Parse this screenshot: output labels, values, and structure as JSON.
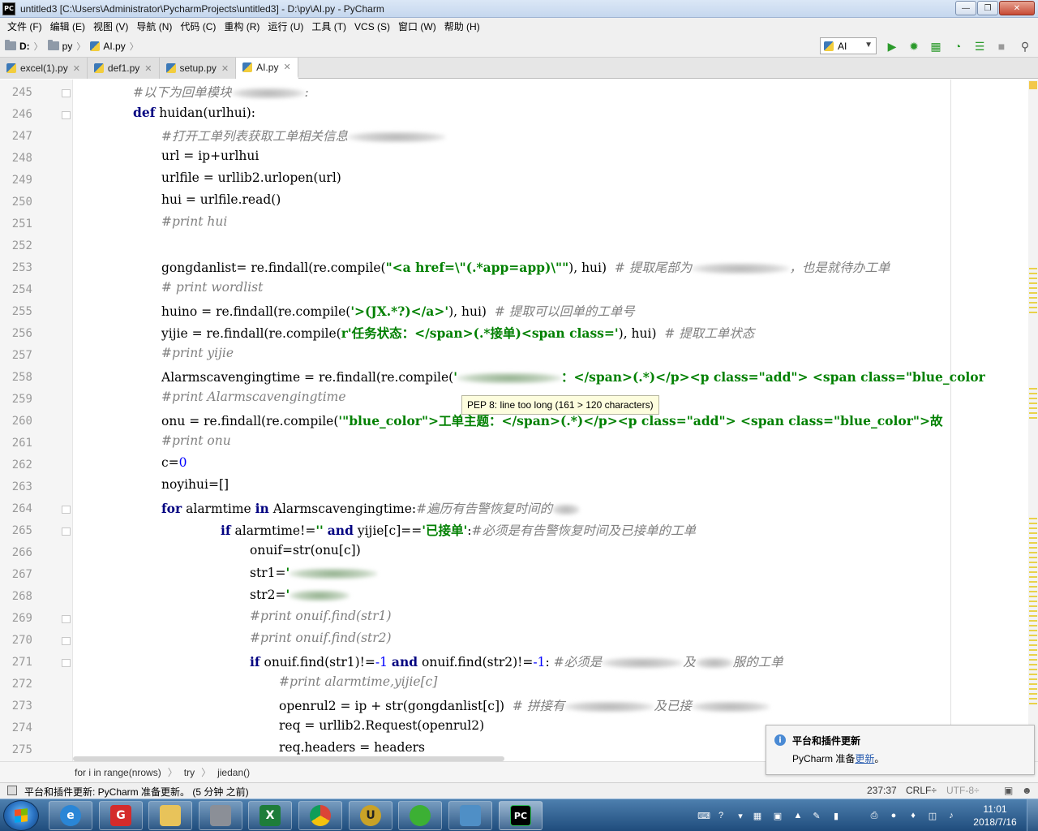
{
  "window": {
    "app_icon_text": "PC",
    "title": "untitled3 [C:\\Users\\Administrator\\PycharmProjects\\untitled3] - D:\\py\\AI.py - PyCharm"
  },
  "menu": [
    "文件 (F)",
    "编辑 (E)",
    "视图 (V)",
    "导航 (N)",
    "代码 (C)",
    "重构 (R)",
    "运行 (U)",
    "工具 (T)",
    "VCS (S)",
    "窗口 (W)",
    "帮助 (H)"
  ],
  "navbar": {
    "crumbs": [
      "D:",
      "py",
      "AI.py"
    ],
    "run_config": "AI"
  },
  "tabs": [
    {
      "label": "excel(1).py",
      "active": false
    },
    {
      "label": "def1.py",
      "active": false
    },
    {
      "label": "setup.py",
      "active": false
    },
    {
      "label": "AI.py",
      "active": true
    }
  ],
  "editor": {
    "line_numbers": [
      "245",
      "246",
      "247",
      "248",
      "249",
      "250",
      "251",
      "252",
      "253",
      "254",
      "255",
      "256",
      "257",
      "258",
      "259",
      "260",
      "261",
      "262",
      "263",
      "264",
      "265",
      "266",
      "267",
      "268",
      "269",
      "270",
      "271",
      "272",
      "273",
      "274",
      "275"
    ],
    "lines": {
      "l245": "#以下为回单模块",
      "l245b": ":",
      "l246_kw": "def",
      "l246_rest": " huidan(urlhui):",
      "l247": "#打开工单列表获取工单相关信息",
      "l248": "url = ip+urlhui",
      "l249": "urlfile = urllib2.urlopen(url)",
      "l250": "hui = urlfile.read()",
      "l251": "#print hui",
      "l253_a": "gongdanlist= re.findall(re.compile(",
      "l253_s": "\"<a href=\\\"(.*app=app)\\\"\"",
      "l253_b": "), hui)  ",
      "l253_c": "# 提取尾部为",
      "l253_d": "，也是就待办工单",
      "l254": "# print wordlist",
      "l255_a": "huino = re.findall(re.compile(",
      "l255_s": "'>(JX.*?)</a>'",
      "l255_b": "), hui)  ",
      "l255_c": "# 提取可以回单的工单号",
      "l256_a": "yijie = re.findall(re.compile(",
      "l256_s": "r'任务状态：</span>(.*接单)<span class='",
      "l256_b": "), hui)  ",
      "l256_c": "# 提取工单状态",
      "l257": "#print yijie",
      "l258_a": "Alarmscavengingtime = re.findall(re.compile(",
      "l258_s1": "'",
      "l258_s2": "：</span>(.*)</p><p class=\"add\"> <span class=\"blue_color",
      "l259": "#print Alarmscavengingtime",
      "l260_a": "onu = re.findall(re.compile(",
      "l260_s": "'\"blue_color\">工单主题：</span>(.*)</p><p class=\"add\"> <span class=\"blue_color\">故",
      "l261": "#print onu",
      "l262_a": "c=",
      "l262_n": "0",
      "l263": "noyihui=[]",
      "l264_kw1": "for",
      "l264_a": " alarmtime ",
      "l264_kw2": "in",
      "l264_b": " Alarmscavengingtime:",
      "l264_c": "#遍历有告警恢复时间的",
      "l265_kw1": "if",
      "l265_a": " alarmtime!=",
      "l265_s1": "''",
      "l265_kw2": "and",
      "l265_b": " yijie[c]==",
      "l265_s2": "'已接单'",
      "l265_c": ":",
      "l265_d": "#必须是有告警恢复时间及已接单的工单",
      "l266": "onuif=str(onu[c])",
      "l267_a": "str1=",
      "l267_s": "'",
      "l268_a": "str2=",
      "l268_s": "'",
      "l269": "#print onuif.find(str1)",
      "l270": "#print onuif.find(str2)",
      "l271_kw": "if",
      "l271_a": " onuif.find(str1)!=",
      "l271_n1": "-1",
      "l271_kw2": "and",
      "l271_b": " onuif.find(str2)!=",
      "l271_n2": "-1",
      "l271_c": ": ",
      "l271_d": "#必须是",
      "l271_e": "及",
      "l271_f": "服的工单",
      "l272": "#print alarmtime,yijie[c]",
      "l273_a": "openrul2 = ip + str(gongdanlist[c])  ",
      "l273_c": "# 拼接有",
      "l273_d": "及已接",
      "l274": "req = urllib2.Request(openrul2)",
      "l275": "req.headers = headers"
    },
    "tooltip": "PEP 8: line too long (161 > 120 characters)"
  },
  "code_breadcrumb": [
    "for i in range(nrows)",
    "try",
    "jiedan()"
  ],
  "notification": {
    "title": "平台和插件更新",
    "body_prefix": "PyCharm 准备",
    "link": "更新",
    "body_suffix": "。"
  },
  "statusbar": {
    "message": "平台和插件更新: PyCharm 准备更新。 (5 分钟 之前)",
    "position": "237:37",
    "line_sep": "CRLF÷",
    "encoding": "UTF-8÷"
  },
  "taskbar": {
    "time": "11:01",
    "date": "2018/7/16"
  },
  "colors": {
    "keyword": "#000080",
    "string": "#008000",
    "comment": "#808080",
    "number": "#0000ff"
  }
}
